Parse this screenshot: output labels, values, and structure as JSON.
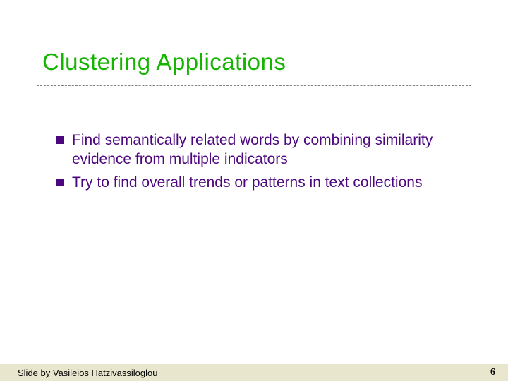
{
  "title": "Clustering Applications",
  "bullets": [
    "Find semantically related words by combining similarity evidence from multiple indicators",
    "Try to find overall trends or patterns in text collections"
  ],
  "footer": {
    "credit": "Slide by Vasileios Hatzivassiloglou",
    "page": "6"
  }
}
